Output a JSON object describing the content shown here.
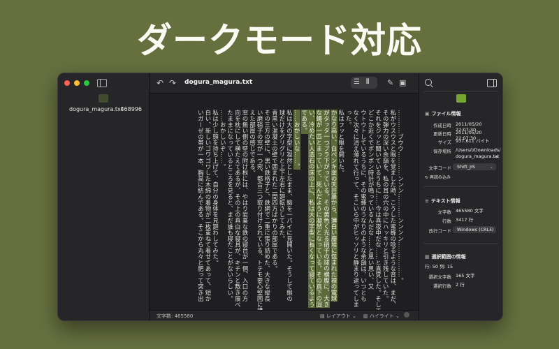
{
  "headline": "ダークモード対応",
  "window": {
    "sidebar": {
      "file_name": "dogura_magura.txt",
      "file_count": "468996"
    },
    "toolbar": {
      "title": "dogura_magura.txt",
      "undo_icon": "undo-arrow-icon",
      "redo_icon": "redo-arrow-icon"
    },
    "content": {
      "columns": [
        "…………ブウウ…………ンンン…………ンンンン………………。",
        "私がウスウスと眼を覚ました時、こうした蜜蜂の唸るような音は、まだ、",
        "その弾力の深い余韻を、私の耳の穴の中にハッキリと引き残していた。",
        "それをジッと聞いているうちに……今は真夜中だな……と直覚した。そして",
        "どこか近くでボンボン時計が鳴っているんだな……と思い思い、又",
        "ウトウトしているうちに、その蜜蜂のうなりのような余韻は、いつとも",
        "なく次々に消え薄れて行って、そこいら中がヒッソリと静まり返ってしま",
        "った。",
        "私はフッと眼を開いた。",
        "かなり高い、白ペンキ塗の天井裏から、薄白い塵埃に包まれた裸の電球",
        "がタッタ一つブラ下がっている。その黄色く光る硝子の球の横腹に、大き",
        "な蠅が一匹とまっていて、死んだように凝然となっている。その真下の固",
        "い、冷めたい人造石の床の上に、私は大の字型に長くなって寝ているよう",
        "である。",
        "……おかしいな……。",
        "私は大の字型に凝然としたまま、瞼を一パイに見開いた。そうして眼の",
        "球だけをグリグリと上下左右に廻転さしてみた。",
        "青黒い混凝土の壁で囲まれた二間四方ばかりの部屋である。",
        "その三方の壁に、黒い鉄格子と、鉄網で二重に張り詰めた、大きな縦長",
        "い磨硝子の窓が一つ宛、都合三つ取り付けられている、トテモ要心堅固に構",
        "えた部屋の感じである。",
        "窓の無い側の壁の附け根には、やはり岩乗な鉄の寝台が一個、入口の方",
        "向を枕にして横たえてあるが、その上の真白な寝具が、キチンと敷き展べ",
        "たままになっているところを見ると、まだ誰も寝たことがないらしい。",
        "……おかしいぞ……。",
        "私は少し頭を持ち上げて、自分の身体を見廻わしてみた。",
        "白い、新しいゴワゴワした木綿の着物が二枚重ねて着せてあって、短か",
        "いガーゼの帯が一本、胸高に結んである。そこから丸々と肥って突き出"
      ]
    },
    "statusbar": {
      "char_count": "文字数: 465580",
      "layout_label": "レイアウト",
      "highlight_label": "ハイライト"
    },
    "inspector": {
      "file_info_title": "ファイル情報",
      "created_label": "作成日時",
      "created_value": "2011/05/20 22:07:30",
      "modified_label": "更新日時",
      "modified_value": "2011/05/20 22:07:30",
      "size_label": "サイズ",
      "size_value": "937,611 バイト",
      "location_label": "保存場所",
      "location_value_1": "/Users/l/Downloads/",
      "location_value_2": "dogura_magura.txt",
      "encoding_label": "文字コード",
      "encoding_value": "Shift_JIS",
      "reload_label": "再読み込み",
      "text_info_title": "テキスト情報",
      "chars_label": "文字数",
      "chars_value": "465580 文字",
      "lines_label": "行数",
      "lines_value": "3417 行",
      "newline_label": "改行コード",
      "newline_value": "Windows (CRLF)",
      "selection_title": "選択範囲の情報",
      "cursor_pos": "行: 50 列: 15",
      "sel_chars_label": "選択文字数",
      "sel_chars_value": "165 文字",
      "sel_lines_label": "選択行数",
      "sel_lines_value": "2 行"
    }
  },
  "colors": {
    "background": "#66703f",
    "highlight": "#5c6a3a",
    "accent_icon": "#74a62f"
  }
}
